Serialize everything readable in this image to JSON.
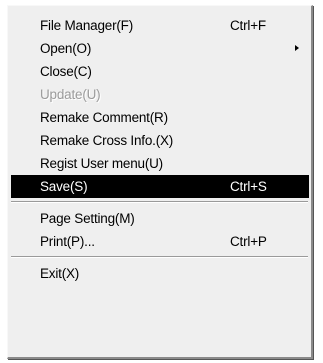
{
  "menu": {
    "items": [
      {
        "label": "File Manager(F)",
        "shortcut": "Ctrl+F"
      },
      {
        "label": "Open(O)",
        "shortcut": ""
      },
      {
        "label": "Close(C)",
        "shortcut": ""
      },
      {
        "label": "Update(U)",
        "shortcut": ""
      },
      {
        "label": "Remake Comment(R)",
        "shortcut": ""
      },
      {
        "label": "Remake Cross Info.(X)",
        "shortcut": ""
      },
      {
        "label": "Regist User menu(U)",
        "shortcut": ""
      },
      {
        "label": "Save(S)",
        "shortcut": "Ctrl+S"
      },
      {
        "label": "Page Setting(M)",
        "shortcut": ""
      },
      {
        "label": "Print(P)...",
        "shortcut": "Ctrl+P"
      },
      {
        "label": "Exit(X)",
        "shortcut": ""
      }
    ],
    "submenu_icon": "triangle-right-icon",
    "colors": {
      "background": "#efefef",
      "highlight": "#000000",
      "highlight_text": "#ffffff",
      "disabled_text": "#9c9c9c"
    }
  }
}
